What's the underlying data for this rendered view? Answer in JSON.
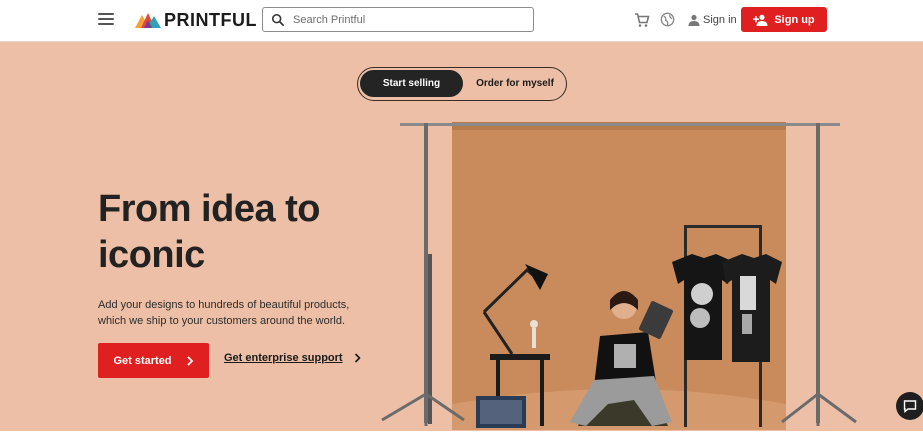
{
  "header": {
    "logo_text": "PRINTFUL",
    "search_placeholder": "Search Printful",
    "signin_label": "Sign in",
    "signup_label": "Sign up"
  },
  "toggle": {
    "active_label": "Start selling",
    "other_label": "Order for myself"
  },
  "hero": {
    "headline_line1": "From idea to",
    "headline_line2": "iconic",
    "subtext": "Add your designs to hundreds of beautiful products, which we ship to your customers around the world.",
    "cta_label": "Get started",
    "enterprise_label": "Get enterprise support"
  },
  "icons": {
    "menu": "hamburger-icon",
    "search": "search-icon",
    "cart": "cart-icon",
    "globe": "globe-icon",
    "user": "user-icon",
    "add_user": "add-user-icon",
    "chevron": "chevron-right-icon",
    "chat": "chat-icon"
  },
  "colors": {
    "accent": "#e02020",
    "background": "#ecbfa6",
    "dark": "#242424"
  }
}
